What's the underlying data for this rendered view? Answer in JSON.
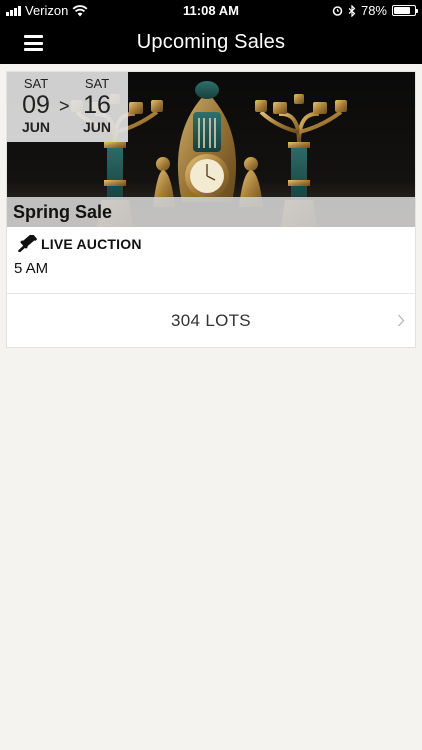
{
  "status_bar": {
    "carrier": "Verizon",
    "time": "11:08 AM",
    "battery_percent": "78%",
    "battery_level": 0.78
  },
  "nav": {
    "title": "Upcoming Sales",
    "menu_icon": "hamburger-menu-icon"
  },
  "sale": {
    "start": {
      "dow": "SAT",
      "day": "09",
      "month": "JUN"
    },
    "separator": ">",
    "end": {
      "dow": "SAT",
      "day": "16",
      "month": "JUN"
    },
    "name": "Spring Sale",
    "type_icon": "gavel-icon",
    "type_label": "LIVE AUCTION",
    "time": "5 AM",
    "lots_label": "304 LOTS"
  }
}
